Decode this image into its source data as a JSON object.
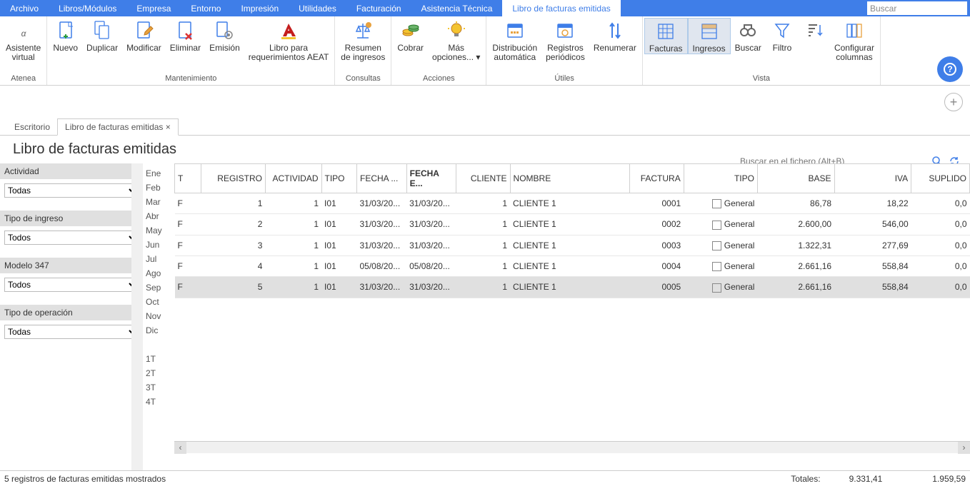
{
  "menu": {
    "items": [
      "Archivo",
      "Libros/Módulos",
      "Empresa",
      "Entorno",
      "Impresión",
      "Utilidades",
      "Facturación",
      "Asistencia Técnica",
      "Libro de facturas emitidas"
    ],
    "active": 8,
    "search_placeholder": "Buscar"
  },
  "ribbon": {
    "groups": [
      {
        "label": "Atenea",
        "buttons": [
          {
            "name": "asistente",
            "label": "Asistente\nvirtual",
            "icon": "alpha"
          }
        ]
      },
      {
        "label": "Mantenimiento",
        "buttons": [
          {
            "name": "nuevo",
            "label": "Nuevo",
            "icon": "doc-plus"
          },
          {
            "name": "duplicar",
            "label": "Duplicar",
            "icon": "doc-copy"
          },
          {
            "name": "modificar",
            "label": "Modificar",
            "icon": "doc-edit"
          },
          {
            "name": "eliminar",
            "label": "Eliminar",
            "icon": "doc-del"
          },
          {
            "name": "emision",
            "label": "Emisión",
            "icon": "doc-gear"
          },
          {
            "name": "libro-aeat",
            "label": "Libro para\nrequerimientos AEAT",
            "icon": "aeat",
            "wide": true
          }
        ]
      },
      {
        "label": "Consultas",
        "buttons": [
          {
            "name": "resumen",
            "label": "Resumen\nde ingresos",
            "icon": "scales",
            "wide": true
          }
        ]
      },
      {
        "label": "Acciones",
        "buttons": [
          {
            "name": "cobrar",
            "label": "Cobrar",
            "icon": "coins"
          },
          {
            "name": "mas-opciones",
            "label": "Más\nopciones... ▾",
            "icon": "bulb"
          }
        ]
      },
      {
        "label": "Útiles",
        "buttons": [
          {
            "name": "distribucion",
            "label": "Distribución\nautomática",
            "icon": "calendar-dist",
            "wide": true
          },
          {
            "name": "registros",
            "label": "Registros\nperiódicos",
            "icon": "calendar-rep"
          },
          {
            "name": "renumerar",
            "label": "Renumerar",
            "icon": "arrows"
          }
        ]
      },
      {
        "label": "Vista",
        "buttons": [
          {
            "name": "facturas",
            "label": "Facturas",
            "icon": "grid",
            "sel": true
          },
          {
            "name": "ingresos",
            "label": "Ingresos",
            "icon": "grid2",
            "sel": true
          },
          {
            "name": "buscar",
            "label": "Buscar",
            "icon": "binoc"
          },
          {
            "name": "filtro",
            "label": "Filtro",
            "icon": "funnel"
          },
          {
            "name": "orden",
            "label": "",
            "icon": "sort",
            "narrow": true
          },
          {
            "name": "columnas",
            "label": "Configurar\ncolumnas",
            "icon": "cols"
          }
        ]
      }
    ]
  },
  "doc_tabs": {
    "items": [
      "Escritorio",
      "Libro de facturas emitidas ×"
    ],
    "active": 1
  },
  "page_title": "Libro de facturas emitidas",
  "filters": [
    {
      "label": "Actividad",
      "value": "Todas"
    },
    {
      "label": "Tipo de ingreso",
      "value": "Todos"
    },
    {
      "label": "Modelo 347",
      "value": "Todos"
    },
    {
      "label": "Tipo de operación",
      "value": "Todas"
    }
  ],
  "months": [
    "Ene",
    "Feb",
    "Mar",
    "Abr",
    "May",
    "Jun",
    "Jul",
    "Ago",
    "Sep",
    "Oct",
    "Nov",
    "Dic",
    "",
    "1T",
    "2T",
    "3T",
    "4T"
  ],
  "search_placeholder": "Buscar en el fichero (Alt+B)",
  "columns": [
    {
      "h": "T",
      "w": 34
    },
    {
      "h": "REGISTRO",
      "w": 84,
      "r": true
    },
    {
      "h": "ACTIVIDAD",
      "w": 70,
      "r": true
    },
    {
      "h": "TIPO",
      "w": 46
    },
    {
      "h": "FECHA ...",
      "w": 62
    },
    {
      "h": "FECHA E...",
      "w": 62,
      "bold": true
    },
    {
      "h": "CLIENTE",
      "w": 70,
      "r": true
    },
    {
      "h": "NOMBRE",
      "w": 156
    },
    {
      "h": "FACTURA",
      "w": 70,
      "r": true
    },
    {
      "h": "TIPO",
      "w": 96,
      "r": true
    },
    {
      "h": "BASE",
      "w": 100,
      "r": true
    },
    {
      "h": "IVA",
      "w": 100,
      "r": true
    },
    {
      "h": "SUPLIDO",
      "w": 76,
      "r": true
    }
  ],
  "rows": [
    {
      "t": "F",
      "reg": "1",
      "act": "1",
      "tipo": "I01",
      "f1": "31/03/20...",
      "f2": "31/03/20...",
      "cli": "1",
      "nom": "CLIENTE 1",
      "fac": "0001",
      "t2": "General",
      "base": "86,78",
      "iva": "18,22",
      "sup": "0,0"
    },
    {
      "t": "F",
      "reg": "2",
      "act": "1",
      "tipo": "I01",
      "f1": "31/03/20...",
      "f2": "31/03/20...",
      "cli": "1",
      "nom": "CLIENTE 1",
      "fac": "0002",
      "t2": "General",
      "base": "2.600,00",
      "iva": "546,00",
      "sup": "0,0"
    },
    {
      "t": "F",
      "reg": "3",
      "act": "1",
      "tipo": "I01",
      "f1": "31/03/20...",
      "f2": "31/03/20...",
      "cli": "1",
      "nom": "CLIENTE 1",
      "fac": "0003",
      "t2": "General",
      "base": "1.322,31",
      "iva": "277,69",
      "sup": "0,0"
    },
    {
      "t": "F",
      "reg": "4",
      "act": "1",
      "tipo": "I01",
      "f1": "05/08/20...",
      "f2": "05/08/20...",
      "cli": "1",
      "nom": "CLIENTE 1",
      "fac": "0004",
      "t2": "General",
      "base": "2.661,16",
      "iva": "558,84",
      "sup": "0,0"
    },
    {
      "t": "F",
      "reg": "5",
      "act": "1",
      "tipo": "I01",
      "f1": "31/03/20...",
      "f2": "31/03/20...",
      "cli": "1",
      "nom": "CLIENTE 1",
      "fac": "0005",
      "t2": "General",
      "base": "2.661,16",
      "iva": "558,84",
      "sup": "0,0",
      "sel": true
    }
  ],
  "status": {
    "count": "5 registros de facturas emitidas mostrados",
    "totales_label": "Totales:",
    "base": "9.331,41",
    "iva": "1.959,59"
  }
}
